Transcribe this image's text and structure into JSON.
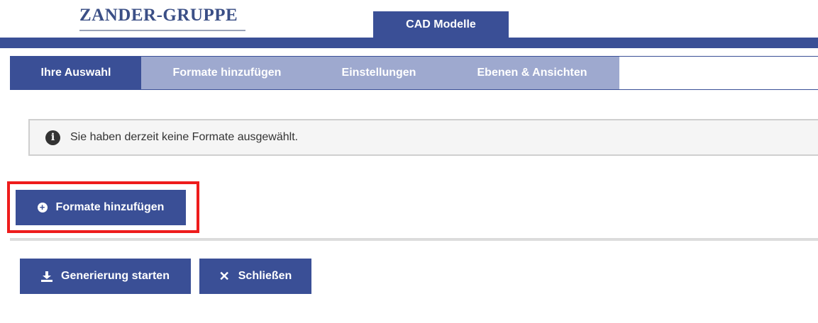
{
  "header": {
    "logo_text": "ZANDER-GRUPPE",
    "top_tab_label": "CAD Modelle"
  },
  "tabs": [
    {
      "label": "Ihre Auswahl",
      "active": true
    },
    {
      "label": "Formate hinzufügen",
      "active": false
    },
    {
      "label": "Einstellungen",
      "active": false
    },
    {
      "label": "Ebenen & Ansichten",
      "active": false
    }
  ],
  "info": {
    "icon": "info-circle-icon",
    "message": "Sie haben derzeit keine Formate ausgewählt."
  },
  "actions": {
    "add_formats_label": "Formate hinzufügen",
    "generate_label": "Generierung starten",
    "close_label": "Schließen"
  },
  "colors": {
    "brand_blue": "#3a4f96",
    "tab_inactive": "#9ea9cf",
    "highlight_red": "#ee1c1c"
  }
}
